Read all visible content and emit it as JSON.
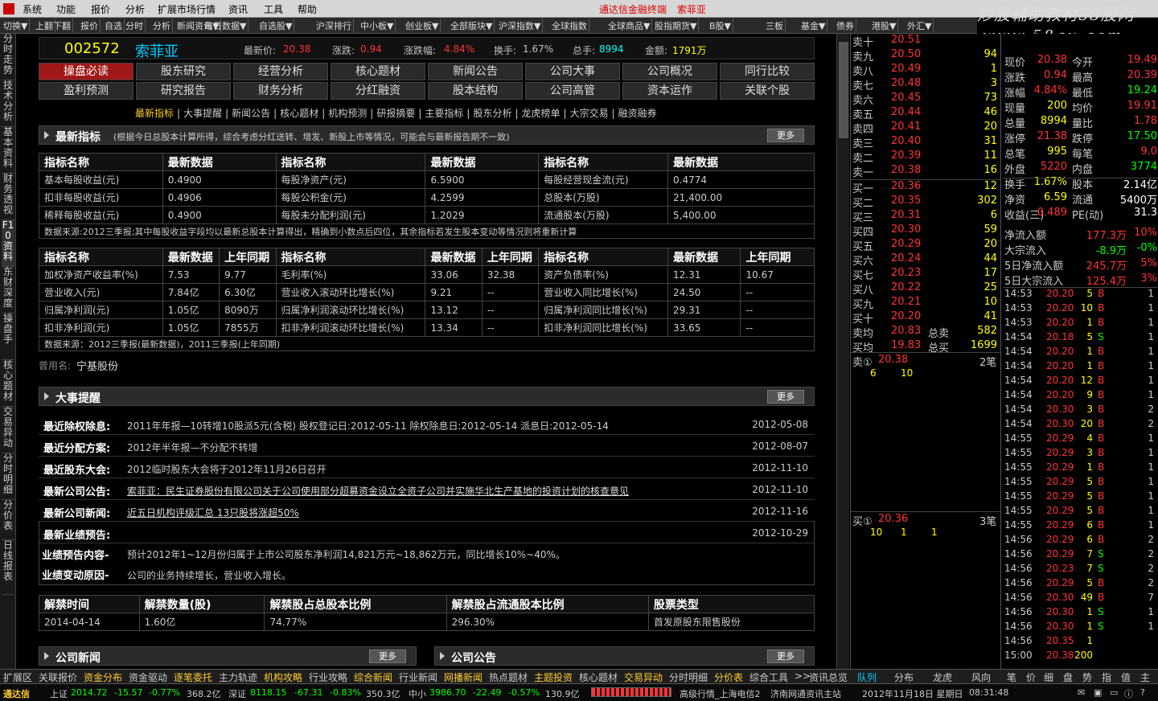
{
  "menu": {
    "items": [
      "系统",
      "功能",
      "报价",
      "分析",
      "扩展市场行情",
      "资讯",
      "工具",
      "帮助"
    ],
    "title": "通达信金融终端",
    "stock": "索菲亚"
  },
  "watermark": {
    "line1": "炒股輔助教材58股网",
    "line2": "www.58gu.com"
  },
  "toolbar": [
    "切换▼",
    "上翻",
    "下翻",
    "报价",
    "自选",
    "分时",
    "分析",
    "新闻资讯▼",
    "每日数据▼",
    "自选股▼",
    "沪深排行",
    "中小板▼",
    "创业板▼",
    "全部版块▼",
    "沪深指数▼",
    "全球指数",
    "全球商品▼",
    "股指期货▼",
    "B股▼",
    "三板",
    "基金▼",
    "债券",
    "港股▼",
    "外汇▼"
  ],
  "left_tabs": [
    "分时走势",
    "技术分析",
    "基本资料",
    "财务透视",
    "F10资料",
    "东财深度",
    "操盘手",
    "核心题材",
    "交易异动",
    "分时明细",
    "分价表",
    "日线报表"
  ],
  "header": {
    "code": "002572",
    "name": "索菲亚",
    "price_label": "最新价:",
    "price": "20.38",
    "chg_label": "涨跌:",
    "chg": "0.94",
    "pct_label": "涨跌幅:",
    "pct": "4.84%",
    "turn_label": "换手:",
    "turn": "1.67%",
    "vol_label": "总手:",
    "vol": "8994",
    "amt_label": "金额:",
    "amt": "1791万"
  },
  "nav": {
    "row1": [
      "操盘必读",
      "股东研究",
      "经营分析",
      "核心题材",
      "新闻公告",
      "公司大事",
      "公司概况",
      "同行比较"
    ],
    "row2": [
      "盈利预测",
      "研究报告",
      "财务分析",
      "分红融资",
      "股本结构",
      "公司高管",
      "资本运作",
      "关联个股"
    ]
  },
  "sublinks": [
    "最新指标",
    "大事提醒",
    "新闻公告",
    "核心题材",
    "机构预测",
    "研报摘要",
    "主要指标",
    "股东分析",
    "龙虎榜单",
    "大宗交易",
    "融资融券"
  ],
  "sec1": {
    "title": "最新指标",
    "note": "(根据今日总股本计算所得，综合考虑分红送转、增发、新股上市等情况，可能会与最新报告期不一致)",
    "more": "更多"
  },
  "table1": {
    "headers": [
      "指标名称",
      "最新数据",
      "指标名称",
      "最新数据",
      "指标名称",
      "最新数据"
    ],
    "rows": [
      [
        "基本每股收益(元)",
        "0.4900",
        "每股净资产(元)",
        "6.5900",
        "每股经营现金流(元)",
        "0.4774"
      ],
      [
        "扣非每股收益(元)",
        "0.4906",
        "每股公积金(元)",
        "4.2599",
        "总股本(万股)",
        "21,400.00"
      ],
      [
        "稀释每股收益(元)",
        "0.4900",
        "每股未分配利润(元)",
        "1.2029",
        "流通股本(万股)",
        "5,400.00"
      ]
    ],
    "note": "数据来源:2012三季报;其中每股收益字段均以最新总股本计算得出，精确到小数点后四位，其余指标若发生股本变动等情况则将重新计算"
  },
  "table2": {
    "headers": [
      "指标名称",
      "最新数据",
      "上年同期",
      "指标名称",
      "最新数据",
      "上年同期",
      "指标名称",
      "最新数据",
      "上年同期"
    ],
    "rows": [
      [
        "加权净资产收益率(%)",
        "7.53",
        "9.77",
        "毛利率(%)",
        "33.06",
        "32.38",
        "资产负债率(%)",
        "12.31",
        "10.67"
      ],
      [
        "营业收入(元)",
        "7.84亿",
        "6.30亿",
        "营业收入滚动环比增长(%)",
        "9.21",
        "--",
        "营业收入同比增长(%)",
        "24.50",
        "--"
      ],
      [
        "归属净利润(元)",
        "1.05亿",
        "8090万",
        "归属净利润滚动环比增长(%)",
        "13.12",
        "--",
        "归属净利润同比增长(%)",
        "29.31",
        "--"
      ],
      [
        "扣非净利润(元)",
        "1.05亿",
        "7855万",
        "扣非净利润滚动环比增长(%)",
        "13.34",
        "--",
        "扣非净利润同比增长(%)",
        "33.65",
        "--"
      ]
    ],
    "note": "数据来源：2012三季报(最新数据)，2011三季报(上年同期)"
  },
  "former_name": {
    "label": "曾用名:",
    "value": "宁基股份"
  },
  "sec2": {
    "title": "大事提醒",
    "more": "更多"
  },
  "events": [
    {
      "k": "最近除权除息:",
      "v": "2011年年报—10转增10股派5元(含税) 股权登记日:2012-05-11 除权除息日:2012-05-14 派息日:2012-05-14",
      "d": "2012-05-08"
    },
    {
      "k": "最近分配方案:",
      "v": "2012年半年报—不分配不转增",
      "d": "2012-08-07"
    },
    {
      "k": "最近股东大会:",
      "v": "2012临时股东大会将于2012年11月26日召开",
      "d": "2012-11-10"
    },
    {
      "k": "最新公司公告:",
      "v": "索菲亚：民生证券股份有限公司关于公司使用部分超募资金设立全资子公司并实施华北生产基地的投资计划的核查意见",
      "d": "2012-11-10"
    },
    {
      "k": "最新公司新闻:",
      "v": "近五日机构评级汇总 13只股将涨超50%",
      "d": "2012-11-16"
    },
    {
      "k": "最新业绩预告:",
      "v": "",
      "d": "2012-10-29"
    }
  ],
  "forecast": {
    "k1": "业绩预告内容-",
    "v1": "预计2012年1~12月份归属于上市公司股东净利润14,821万元~18,862万元，同比增长10%~40%。",
    "k2": "业绩变动原因-",
    "v2": "公司的业务持续增长，营业收入增长。"
  },
  "table3": {
    "headers": [
      "解禁时间",
      "解禁数量(股)",
      "解禁股占总股本比例",
      "解禁股占流通股本比例",
      "股票类型"
    ],
    "rows": [
      [
        "2014-04-14",
        "1.60亿",
        "74.77%",
        "296.30%",
        "首发原股东限售股份"
      ]
    ]
  },
  "sec3": {
    "title": "公司新闻",
    "more": "更多"
  },
  "sec4": {
    "title": "公司公告",
    "more": "更多"
  },
  "orderbook": {
    "asks": [
      [
        "卖十",
        "20.51",
        "",
        ""
      ],
      [
        "卖九",
        "20.50",
        "94",
        ""
      ],
      [
        "卖八",
        "20.49",
        "1",
        ""
      ],
      [
        "卖七",
        "20.48",
        "3",
        ""
      ],
      [
        "卖六",
        "20.45",
        "73",
        ""
      ],
      [
        "卖五",
        "20.44",
        "46",
        ""
      ],
      [
        "卖四",
        "20.41",
        "20",
        ""
      ],
      [
        "卖三",
        "20.40",
        "31",
        ""
      ],
      [
        "卖二",
        "20.39",
        "11",
        ""
      ],
      [
        "卖一",
        "20.38",
        "16",
        ""
      ]
    ],
    "bids": [
      [
        "买一",
        "20.36",
        "12",
        ""
      ],
      [
        "买二",
        "20.35",
        "302",
        ""
      ],
      [
        "买三",
        "20.31",
        "6",
        ""
      ],
      [
        "买四",
        "20.30",
        "59",
        ""
      ],
      [
        "买五",
        "20.29",
        "20",
        ""
      ],
      [
        "买六",
        "20.24",
        "44",
        ""
      ],
      [
        "买七",
        "20.23",
        "17",
        ""
      ],
      [
        "买八",
        "20.22",
        "25",
        ""
      ],
      [
        "买九",
        "20.21",
        "10",
        ""
      ],
      [
        "买十",
        "20.20",
        "41",
        ""
      ]
    ],
    "avg": [
      [
        "卖均",
        "20.83",
        "总卖",
        "582"
      ],
      [
        "买均",
        "19.83",
        "总买",
        "1699"
      ]
    ],
    "sell1": {
      "label": "卖①",
      "price": "20.38",
      "n": "2笔",
      "q": [
        "6",
        "10"
      ]
    },
    "buy1": {
      "label": "买①",
      "price": "20.36",
      "n": "3笔",
      "q": [
        "10",
        "1",
        "1"
      ]
    }
  },
  "stats": [
    [
      "现价",
      "20.38",
      "今开",
      "19.49"
    ],
    [
      "涨跌",
      "0.94",
      "最高",
      "20.39"
    ],
    [
      "涨幅",
      "4.84%",
      "最低",
      "19.24"
    ],
    [
      "现量",
      "200",
      "均价",
      "19.91"
    ],
    [
      "总量",
      "8994",
      "量比",
      "1.78"
    ],
    [
      "涨停",
      "21.38",
      "跌停",
      "17.50"
    ],
    [
      "总笔",
      "995",
      "每笔",
      "9.0"
    ],
    [
      "外盘",
      "5220",
      "内盘",
      "3774"
    ],
    [
      "换手",
      "1.67%",
      "股本",
      "2.14亿"
    ],
    [
      "净资",
      "6.59",
      "流通",
      "5400万"
    ],
    [
      "收益(三)",
      "0.489",
      "PE(动)",
      "31.3"
    ]
  ],
  "flows": [
    [
      "净流入额",
      "177.3万",
      "10%"
    ],
    [
      "大宗流入",
      "-8.9万",
      "-0%"
    ],
    [
      "5日净流入额",
      "245.7万",
      "5%"
    ],
    [
      "5日大宗流入",
      "125.4万",
      "3%"
    ]
  ],
  "ticks": [
    [
      "14:53",
      "20.20",
      "5",
      "B",
      "1"
    ],
    [
      "14:53",
      "20.20",
      "10",
      "B",
      "1"
    ],
    [
      "14:53",
      "20.20",
      "1",
      "B",
      "1"
    ],
    [
      "14:54",
      "20.18",
      "5",
      "S",
      "1"
    ],
    [
      "14:54",
      "20.20",
      "1",
      "B",
      "1"
    ],
    [
      "14:54",
      "20.20",
      "1",
      "B",
      "1"
    ],
    [
      "14:54",
      "20.20",
      "12",
      "B",
      "1"
    ],
    [
      "14:54",
      "20.20",
      "9",
      "B",
      "1"
    ],
    [
      "14:54",
      "20.30",
      "3",
      "B",
      "2"
    ],
    [
      "14:54",
      "20.30",
      "20",
      "B",
      "2"
    ],
    [
      "14:55",
      "20.29",
      "4",
      "B",
      "1"
    ],
    [
      "14:55",
      "20.29",
      "3",
      "B",
      "1"
    ],
    [
      "14:55",
      "20.29",
      "1",
      "B",
      "1"
    ],
    [
      "14:55",
      "20.29",
      "5",
      "B",
      "1"
    ],
    [
      "14:55",
      "20.29",
      "5",
      "B",
      "1"
    ],
    [
      "14:55",
      "20.29",
      "5",
      "B",
      "1"
    ],
    [
      "14:55",
      "20.29",
      "6",
      "B",
      "1"
    ],
    [
      "14:56",
      "20.29",
      "6",
      "B",
      "2"
    ],
    [
      "14:56",
      "20.29",
      "7",
      "S",
      "2"
    ],
    [
      "14:56",
      "20.23",
      "7",
      "S",
      "2"
    ],
    [
      "14:56",
      "20.29",
      "5",
      "B",
      "2"
    ],
    [
      "14:56",
      "20.30",
      "49",
      "B",
      "7"
    ],
    [
      "14:56",
      "20.30",
      "1",
      "S",
      "1"
    ],
    [
      "14:56",
      "20.30",
      "1",
      "S",
      "1"
    ],
    [
      "14:56",
      "20.35",
      "1",
      "",
      ""
    ],
    [
      "15:00",
      "20.38",
      "200",
      "",
      ""
    ]
  ],
  "bottom_tabs": [
    "扩展区",
    "关联报价",
    "资金分布",
    "资金驱动",
    "逐笔委托",
    "主力轨迹",
    "机构攻略",
    "行业攻略",
    "综合新闻",
    "行业新闻",
    "网播新闻",
    "热点题材",
    "主题投资",
    "核心题材",
    "交易异动",
    "分时明细",
    "分价表",
    "综合工具",
    ">>",
    "资讯总览",
    "队列",
    "分布",
    "龙虎",
    "风向",
    "笔",
    "价",
    "细",
    "盘",
    "势",
    "指",
    "值",
    "主"
  ],
  "status": {
    "brand": "通达信",
    "sh_label": "上证",
    "sh": "2014.72",
    "sh_chg": "-15.57",
    "sh_pct": "-0.77%",
    "sh_amt": "368.2亿",
    "sz_label": "深证",
    "sz": "8118.15",
    "sz_chg": "-67.31",
    "sz_pct": "-0.83%",
    "sz_amt": "350.3亿",
    "zx_label": "中小",
    "zx": "3986.70",
    "zx_chg": "-22.49",
    "zx_pct": "-0.57%",
    "zx_amt": "130.9亿",
    "server": "高级行情_上海电信2",
    "news": "济南网通资讯主站",
    "date": "2012年11月18日 星期日",
    "time": "08:31:48"
  },
  "colors": {
    "up": "#ff3333",
    "down": "#00ff00",
    "accent": "#a01818",
    "code": "#ffff00"
  }
}
